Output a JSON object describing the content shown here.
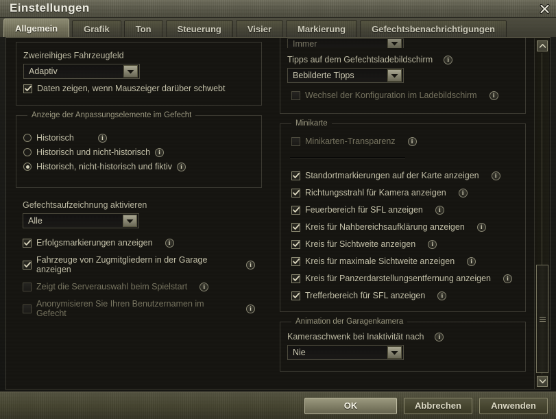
{
  "window": {
    "title": "Einstellungen",
    "close_icon": "close-icon"
  },
  "tabs": [
    {
      "label": "Allgemein",
      "active": true
    },
    {
      "label": "Grafik",
      "active": false
    },
    {
      "label": "Ton",
      "active": false
    },
    {
      "label": "Steuerung",
      "active": false
    },
    {
      "label": "Visier",
      "active": false
    },
    {
      "label": "Markierung",
      "active": false
    },
    {
      "label": "Gefechtsbenachrichtigungen",
      "active": false
    }
  ],
  "left_column": {
    "group_vehicle_panel": {
      "label_two_row": "Zweireihiges Fahrzeugfeld",
      "dropdown_two_row_value": "Adaptiv",
      "checkbox_hover_data": "Daten zeigen, wenn Mauszeiger darüber schwebt"
    },
    "group_customization": {
      "legend": "Anzeige der Anpassungselemente im Gefecht",
      "radio_historical": "Historisch",
      "radio_historical_nonhistorical": "Historisch und nicht-historisch",
      "radio_historical_nonhistorical_fictional": "Historisch, nicht-historisch und fiktiv"
    },
    "group_recording": {
      "label_battle_recording": "Gefechtsaufzeichnung aktivieren",
      "dropdown_recording_value": "Alle",
      "checkbox_achievement_markers": "Erfolgsmarkierungen anzeigen",
      "checkbox_platoon_vehicles": "Fahrzeuge von Zugmitgliedern in der Garage anzeigen",
      "checkbox_server_selection": "Zeigt die Serverauswahl beim Spielstart",
      "checkbox_anonymize_username": "Anonymisieren Sie Ihren Benutzernamen im Gefecht"
    }
  },
  "right_column": {
    "group_loading_screen": {
      "dropdown_cut_value": "Immer",
      "label_tips": "Tipps auf dem Gefechtsladebildschirm",
      "dropdown_tips_value": "Bebilderte Tipps",
      "checkbox_config_switch": "Wechsel der Konfiguration im Ladebildschirm"
    },
    "group_minimap": {
      "legend": "Minikarte",
      "checkbox_transparency": "Minikarten-Transparenz",
      "checkbox_location_markers": "Standortmarkierungen auf der Karte anzeigen",
      "checkbox_camera_ray": "Richtungsstrahl für Kamera anzeigen",
      "checkbox_spg_firing_area": "Feuerbereich für SFL anzeigen",
      "checkbox_close_recon_circle": "Kreis für Nahbereichsaufklärung anzeigen",
      "checkbox_view_range_circle": "Kreis für Sichtweite anzeigen",
      "checkbox_max_view_range_circle": "Kreis für maximale Sichtweite anzeigen",
      "checkbox_draw_distance_circle": "Kreis für Panzerdarstellungsentfernung anzeigen",
      "checkbox_spg_hit_area": "Trefferbereich für SFL anzeigen"
    },
    "group_garage_camera": {
      "legend": "Animation der Garagenkamera",
      "label_camera_pan": "Kameraschwenk bei Inaktivität nach",
      "dropdown_camera_pan_value": "Nie"
    }
  },
  "scrollbar": {
    "up_icon": "chevron-up-icon",
    "down_icon": "chevron-down-icon"
  },
  "footer": {
    "ok": "OK",
    "cancel": "Abbrechen",
    "apply": "Anwenden"
  },
  "icons": {
    "info": "i",
    "dropdown": "triangle-down-icon",
    "check": "check-icon"
  },
  "colors": {
    "accent": "#8d8b72",
    "panel": "#151410",
    "titlebar": "#5b5a4a",
    "text": "#c3c0a8"
  }
}
